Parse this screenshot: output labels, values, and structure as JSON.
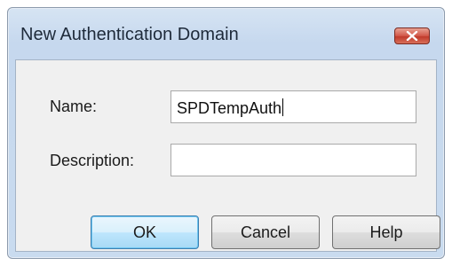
{
  "dialog": {
    "title": "New Authentication Domain",
    "close_icon": "close-icon"
  },
  "form": {
    "name_label": "Name:",
    "name_value": "SPDTempAuth",
    "description_label": "Description:",
    "description_value": ""
  },
  "buttons": {
    "ok": "OK",
    "cancel": "Cancel",
    "help": "Help"
  },
  "colors": {
    "close_button": "#c03a2b",
    "default_button_border": "#3c7fb1"
  }
}
